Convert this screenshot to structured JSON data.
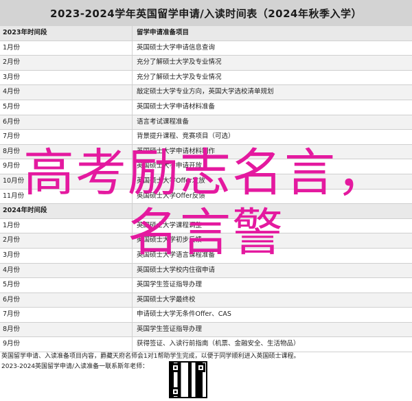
{
  "header": {
    "title": "2023-2024学年英国留学申请/入读时间表（2024年秋季入学）"
  },
  "table": {
    "column_a": "2023年时间段",
    "column_b": "留学申请准备项目",
    "rows_2023": [
      {
        "period": "1月份",
        "task": "英国硕士大学申请信息查询"
      },
      {
        "period": "2月份",
        "task": "充分了解硕士大学及专业情况"
      },
      {
        "period": "3月份",
        "task": "充分了解硕士大学及专业情况"
      },
      {
        "period": "4月份",
        "task": "敲定硕士大学专业方向，英国大学选校清单规划"
      },
      {
        "period": "5月份",
        "task": "英国硕士大学申请材料准备"
      },
      {
        "period": "6月份",
        "task": "语言考试课程准备"
      },
      {
        "period": "7月份",
        "task": "背景提升课程、竞赛项目（可选）"
      },
      {
        "period": "8月份",
        "task": "英国硕士大学申请材料制作"
      },
      {
        "period": "9月份",
        "task": "英国硕士大学申请开放"
      },
      {
        "period": "10月份",
        "task": "英国硕士大学Offer发放"
      },
      {
        "period": "11月份",
        "task": "英国硕士大学Offer反馈"
      }
    ],
    "column_a_2024": "2024年时间段",
    "rows_2024": [
      {
        "period": "1月份",
        "task": "英国硕士大学课程调整"
      },
      {
        "period": "2月份",
        "task": "英国硕士大学初步反馈"
      },
      {
        "period": "3月份",
        "task": "英国硕士大学语言课程准备"
      },
      {
        "period": "4月份",
        "task": "英国硕士大学校内住宿申请"
      },
      {
        "period": "5月份",
        "task": "英国学生签证指导办理"
      },
      {
        "period": "6月份",
        "task": "英国硕士大学最终校"
      },
      {
        "period": "7月份",
        "task": "申请硕士大学无条件Offer、CAS"
      },
      {
        "period": "8月份",
        "task": "英国学生签证指导办理"
      },
      {
        "period": "9月份",
        "task": "获得签证、入读行前指南（机票、金融安全、生活物品）"
      }
    ]
  },
  "footer": {
    "line1": "英国留学申请、入读准备项目内容，爵藏天府名师会1对1帮助学生完成，以便于同学顺利进入英国硕士课程。",
    "line2": "2023-2024英国留学申请/入读准备一联系斯年老师："
  },
  "overlay": {
    "line1": "高考励志名言，",
    "line2": "名言警"
  },
  "colors": {
    "overlay": "#e4199f",
    "title_bg": "#d3d3d3"
  }
}
